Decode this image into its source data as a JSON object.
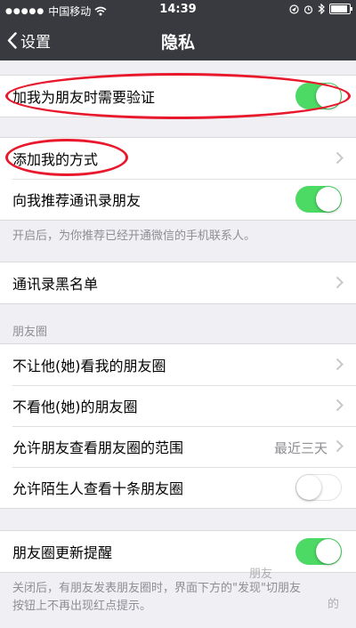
{
  "status_bar": {
    "carrier": "中国移动",
    "time": "14:39",
    "icons": [
      "signal-dots",
      "wifi-icon",
      "location-icon",
      "alarm-icon",
      "bluetooth-icon",
      "battery-icon"
    ]
  },
  "nav": {
    "back_label": "设置",
    "title": "隐私"
  },
  "groups": {
    "verify": {
      "label": "加我为朋友时需要验证",
      "toggle": true
    },
    "add": {
      "rows": [
        {
          "label": "添加我的方式",
          "type": "chevron"
        },
        {
          "label": "向我推荐通讯录朋友",
          "type": "switch",
          "toggle": true
        }
      ],
      "note": "开启后，为你推荐已经开通微信的手机联系人。"
    },
    "blacklist": {
      "label": "通讯录黑名单"
    },
    "moments": {
      "header": "朋友圈",
      "rows": [
        {
          "label": "不让他(她)看我的朋友圈",
          "type": "chevron"
        },
        {
          "label": "不看他(她)的朋友圈",
          "type": "chevron"
        },
        {
          "label": "允许朋友查看朋友圈的范围",
          "type": "value",
          "value": "最近三天"
        },
        {
          "label": "允许陌生人查看十条朋友圈",
          "type": "switch",
          "toggle": false
        }
      ]
    },
    "update": {
      "label": "朋友圈更新提醒",
      "toggle": true,
      "note_line1": "关闭后，有朋友发表朋友圈时，界面下方的\"发现\"切朋友",
      "note_line2": "按钮上不再出现红点提示。"
    }
  },
  "watermark": {
    "text1": "朋友",
    "text2": "的"
  },
  "colors": {
    "nav_bg": "#393a3f",
    "switch_on": "#4cd964",
    "annotation": "#e8192c",
    "background": "#efeff4"
  }
}
